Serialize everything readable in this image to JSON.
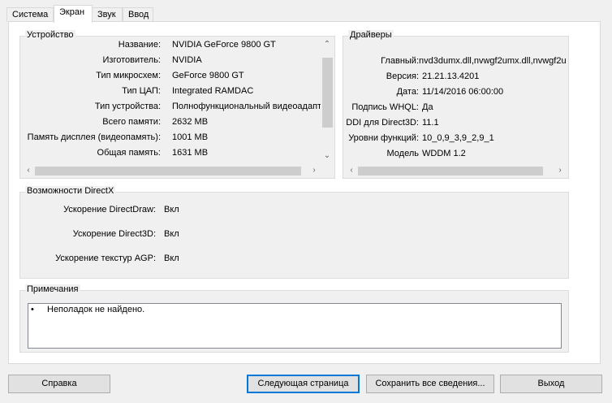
{
  "tabs": [
    "Система",
    "Экран",
    "Звук",
    "Ввод"
  ],
  "device": {
    "title": "Устройство",
    "rows": [
      {
        "k": "Название:",
        "v": "NVIDIA GeForce 9800 GT"
      },
      {
        "k": "Изготовитель:",
        "v": "NVIDIA"
      },
      {
        "k": "Тип микросхем:",
        "v": "GeForce 9800 GT"
      },
      {
        "k": "Тип ЦАП:",
        "v": "Integrated RAMDAC"
      },
      {
        "k": "Тип устройства:",
        "v": "Полнофункциональный видеоадапт"
      },
      {
        "k": "Всего памяти:",
        "v": "2632 MB"
      },
      {
        "k": "Память дисплея (видеопамять):",
        "v": "1001 MB"
      },
      {
        "k": "Общая память:",
        "v": "1631 MB"
      }
    ]
  },
  "drivers": {
    "title": "Драйверы",
    "rows": [
      {
        "k": "Главный:",
        "v": "nvd3dumx.dll,nvwgf2umx.dll,nvwgf2u"
      },
      {
        "k": "Версия:",
        "v": "21.21.13.4201"
      },
      {
        "k": "Дата:",
        "v": "11/14/2016 06:00:00"
      },
      {
        "k": "Подпись WHQL:",
        "v": "Да"
      },
      {
        "k": "DDI для Direct3D:",
        "v": "11.1"
      },
      {
        "k": "Уровни функций:",
        "v": "10_0,9_3,9_2,9_1"
      },
      {
        "k": "Модель",
        "v": "WDDM 1.2"
      }
    ]
  },
  "directx": {
    "title": "Возможности DirectX",
    "rows": [
      {
        "k": "Ускорение DirectDraw:",
        "v": "Вкл"
      },
      {
        "k": "Ускорение Direct3D:",
        "v": "Вкл"
      },
      {
        "k": "Ускорение текстур AGP:",
        "v": "Вкл"
      }
    ]
  },
  "notes": {
    "title": "Примечания",
    "items": [
      "Неполадок не найдено."
    ]
  },
  "buttons": {
    "help": "Справка",
    "next": "Следующая страница",
    "save": "Сохранить все сведения...",
    "exit": "Выход"
  }
}
